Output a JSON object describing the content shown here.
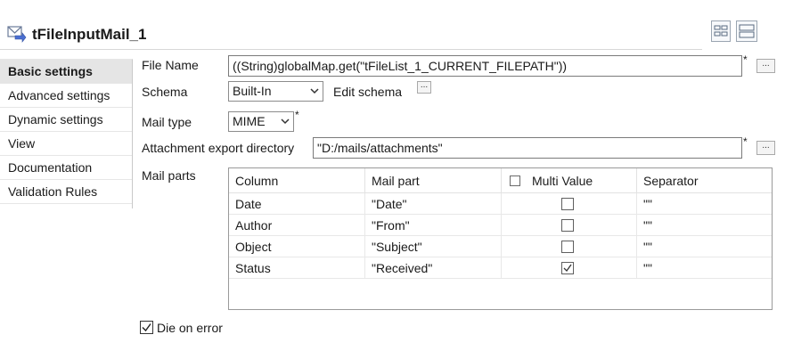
{
  "header": {
    "title": "tFileInputMail_1",
    "title_icon": "mail-input-icon",
    "view_buttons": [
      "grid-view-icon",
      "list-view-icon"
    ]
  },
  "sidebar": {
    "items": [
      {
        "label": "Basic settings",
        "active": true
      },
      {
        "label": "Advanced settings",
        "active": false
      },
      {
        "label": "Dynamic settings",
        "active": false
      },
      {
        "label": "View",
        "active": false
      },
      {
        "label": "Documentation",
        "active": false
      },
      {
        "label": "Validation Rules",
        "active": false
      }
    ]
  },
  "form": {
    "file_name": {
      "label": "File Name",
      "value": "((String)globalMap.get(\"tFileList_1_CURRENT_FILEPATH\"))",
      "required_mark": "*",
      "browse_label": "..."
    },
    "schema": {
      "label": "Schema",
      "value": "Built-In",
      "edit_label": "Edit schema",
      "edit_button": "..."
    },
    "mail_type": {
      "label": "Mail type",
      "value": "MIME",
      "required_mark": "*"
    },
    "attachment_dir": {
      "label": "Attachment export directory",
      "value": "\"D:/mails/attachments\"",
      "required_mark": "*",
      "browse_label": "..."
    },
    "mail_parts": {
      "label": "Mail parts",
      "columns": [
        "Column",
        "Mail part",
        "Multi Value",
        "Separator"
      ],
      "rows": [
        {
          "column": "Date",
          "mail_part": "\"Date\"",
          "multi_value": false,
          "separator": "\"\""
        },
        {
          "column": "Author",
          "mail_part": "\"From\"",
          "multi_value": false,
          "separator": "\"\""
        },
        {
          "column": "Object",
          "mail_part": "\"Subject\"",
          "multi_value": false,
          "separator": "\"\""
        },
        {
          "column": "Status",
          "mail_part": "\"Received\"",
          "multi_value": true,
          "separator": "\"\""
        }
      ]
    },
    "die_on_error": {
      "label": "Die on error",
      "checked": true
    }
  }
}
